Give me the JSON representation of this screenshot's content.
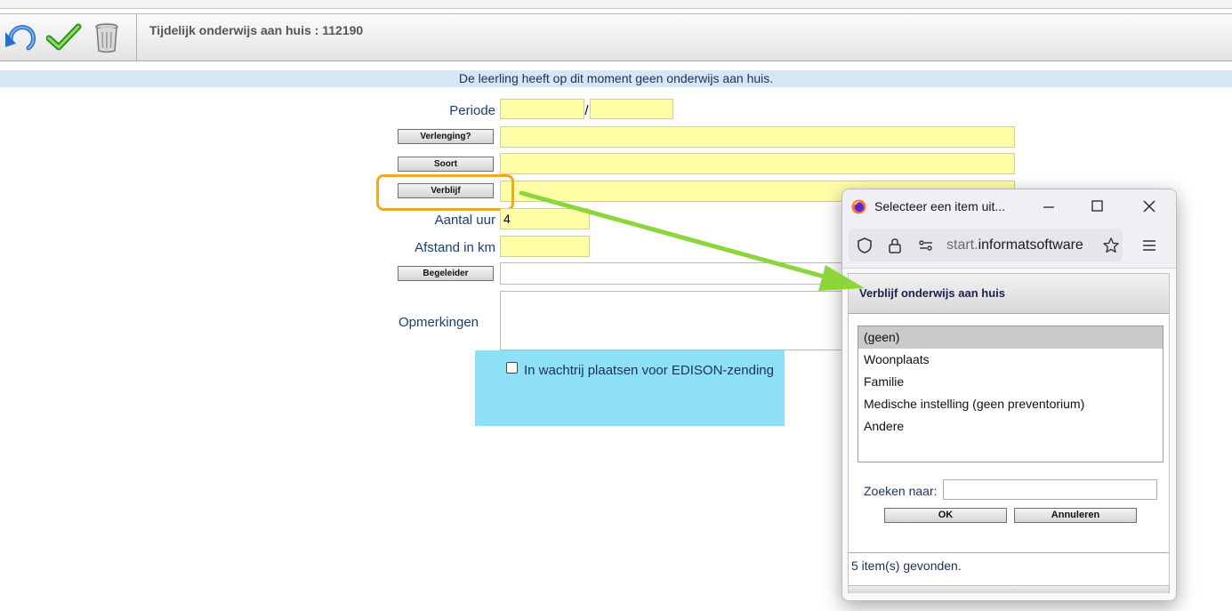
{
  "toolbar": {
    "title": "Tijdelijk onderwijs aan huis : 112190"
  },
  "info_message": "De leerling heeft op dit moment geen onderwijs aan huis.",
  "form": {
    "periode_label": "Periode",
    "periode_separator": "/",
    "periode_start": "",
    "periode_end": "",
    "verlenging_button": "Verlenging?",
    "soort_button": "Soort",
    "verblijf_button": "Verblijf",
    "aantal_uur_label": "Aantal uur",
    "aantal_uur_value": "4",
    "afstand_label": "Afstand in km",
    "afstand_value": "",
    "begeleider_button": "Begeleider",
    "opmerkingen_label": "Opmerkingen",
    "edison_checkbox_label": "In wachtrij plaatsen voor EDISON-zending",
    "edison_checked": false
  },
  "popup": {
    "window_title": "Selecteer een item uit...",
    "url_prefix": "start.",
    "url_host": "informatsoftware",
    "header": "Verblijf onderwijs aan huis",
    "items": [
      {
        "label": "(geen)",
        "selected": true
      },
      {
        "label": "Woonplaats",
        "selected": false
      },
      {
        "label": "Familie",
        "selected": false
      },
      {
        "label": "Medische instelling (geen preventorium)",
        "selected": false
      },
      {
        "label": "Andere",
        "selected": false
      }
    ],
    "search_label": "Zoeken naar:",
    "search_value": "",
    "ok_button": "OK",
    "cancel_button": "Annuleren",
    "status": "5 item(s) gevonden."
  },
  "colors": {
    "field_yellow": "#ffffa8",
    "info_bar": "#d7e6f5",
    "edison_bg": "#8de0f8",
    "highlight": "#f0a920",
    "arrow": "#8cd63c"
  }
}
